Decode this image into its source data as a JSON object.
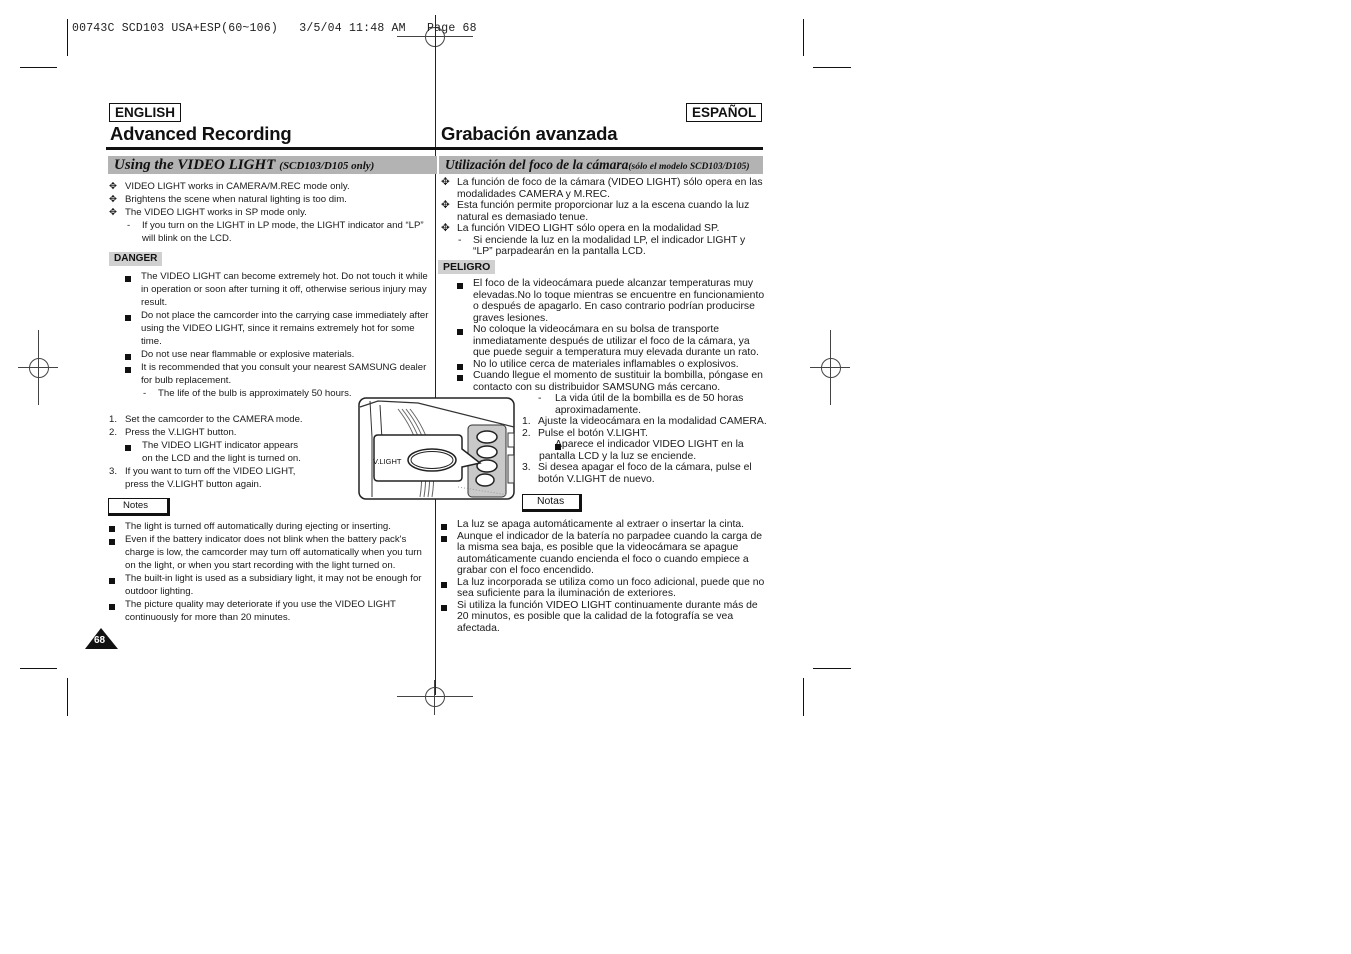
{
  "slug": "00743C SCD103 USA+ESP(60~106)   3/5/04 11:48 AM   Page 68",
  "english": {
    "lang_label": "ENGLISH",
    "title": "Advanced Recording",
    "section_main": "Using the VIDEO LIGHT",
    "section_sub": "(SCD103/D105 only)",
    "bullets": [
      "VIDEO LIGHT works in CAMERA/M.REC mode only.",
      "Brightens the scene when natural lighting is too dim.",
      "The VIDEO LIGHT works in SP mode only."
    ],
    "bullet_sub": "If you turn on the LIGHT in LP mode, the LIGHT indicator and “LP” will blink on the LCD.",
    "danger_label": "DANGER",
    "danger_items": [
      "The VIDEO LIGHT can become extremely hot. Do not touch it while in operation or soon after turning it off, otherwise serious injury may result.",
      "Do not place the camcorder into the carrying case immediately after using the VIDEO LIGHT, since it remains extremely hot for some time.",
      "Do not use near flammable or explosive materials.",
      "It is recommended that you consult your nearest SAMSUNG dealer for bulb replacement."
    ],
    "danger_sub": "The life of the bulb is approximately 50 hours.",
    "steps": [
      "Set the camcorder to the CAMERA mode.",
      "Press the V.LIGHT button.",
      "If you want to turn off the VIDEO LIGHT, press the V.LIGHT button again."
    ],
    "step2_sub": "The VIDEO LIGHT indicator appears on the LCD and the light is turned on.",
    "notes_label": "Notes",
    "notes": [
      "The light is turned off automatically during ejecting or inserting.",
      "Even if the battery indicator does not blink when the battery pack's charge is low, the camcorder may turn off automatically when you turn on the light, or when you start recording with the light turned on.",
      "The built-in light is used as a subsidiary light, it may not be enough for outdoor lighting.",
      "The picture quality may deteriorate if you use the VIDEO LIGHT continuously for more than 20 minutes."
    ],
    "page_number": "68"
  },
  "illustration": {
    "button_label": "V.LIGHT"
  },
  "spanish": {
    "lang_label": "ESPAÑOL",
    "title": "Grabación avanzada",
    "section_main": "Utilización del foco de la cámara",
    "section_sub": "(sólo el modelo SCD103/D105)",
    "bullets": [
      "La función de foco de la cámara (VIDEO LIGHT) sólo opera en las modalidades CAMERA y M.REC.",
      "Esta función permite proporcionar luz a la escena cuando la luz natural es demasiado tenue.",
      "La función VIDEO LIGHT sólo opera en la modalidad SP."
    ],
    "bullet_sub": "Si enciende la luz en la modalidad LP, el indicador LIGHT y “LP” parpadearán en la pantalla LCD.",
    "danger_label": "PELIGRO",
    "danger_items": [
      "El foco de la videocámara puede alcanzar temperaturas muy elevadas.No lo toque mientras se encuentre en funcionamiento o después de apagarlo. En caso contrario podrían producirse graves lesiones.",
      "No coloque la videocámara en su bolsa de transporte inmediatamente después de utilizar el foco de la cámara, ya que puede seguir a temperatura muy elevada durante un rato.",
      "No lo utilice cerca de materiales inflamables o explosivos.",
      "Cuando llegue el momento de sustituir la bombilla, póngase en contacto con su distribuidor SAMSUNG más cercano."
    ],
    "danger_sub": "La vida útil de la bombilla es de 50 horas aproximadamente.",
    "steps": [
      "Ajuste la videocámara en la modalidad CAMERA.",
      "Pulse el botón V.LIGHT.",
      "Si desea apagar el foco de la cámara, pulse el botón V.LIGHT de nuevo."
    ],
    "step2_sub": "Aparece el indicador VIDEO LIGHT en la pantalla LCD y la luz se enciende.",
    "notes_label": "Notas",
    "notes": [
      "La luz se apaga automáticamente al extraer o insertar la cinta.",
      "Aunque el indicador de la batería no parpadee cuando la carga de la misma sea baja, es posible que la videocámara se apague automáticamente cuando encienda el foco o cuando empiece a grabar con el foco encendido.",
      "La luz incorporada se utiliza como un foco adicional, puede que no sea suficiente para la iluminación de exteriores.",
      "Si utiliza la función VIDEO LIGHT continuamente durante más de 20 minutos, es posible que la calidad de la fotografía se vea afectada."
    ]
  }
}
